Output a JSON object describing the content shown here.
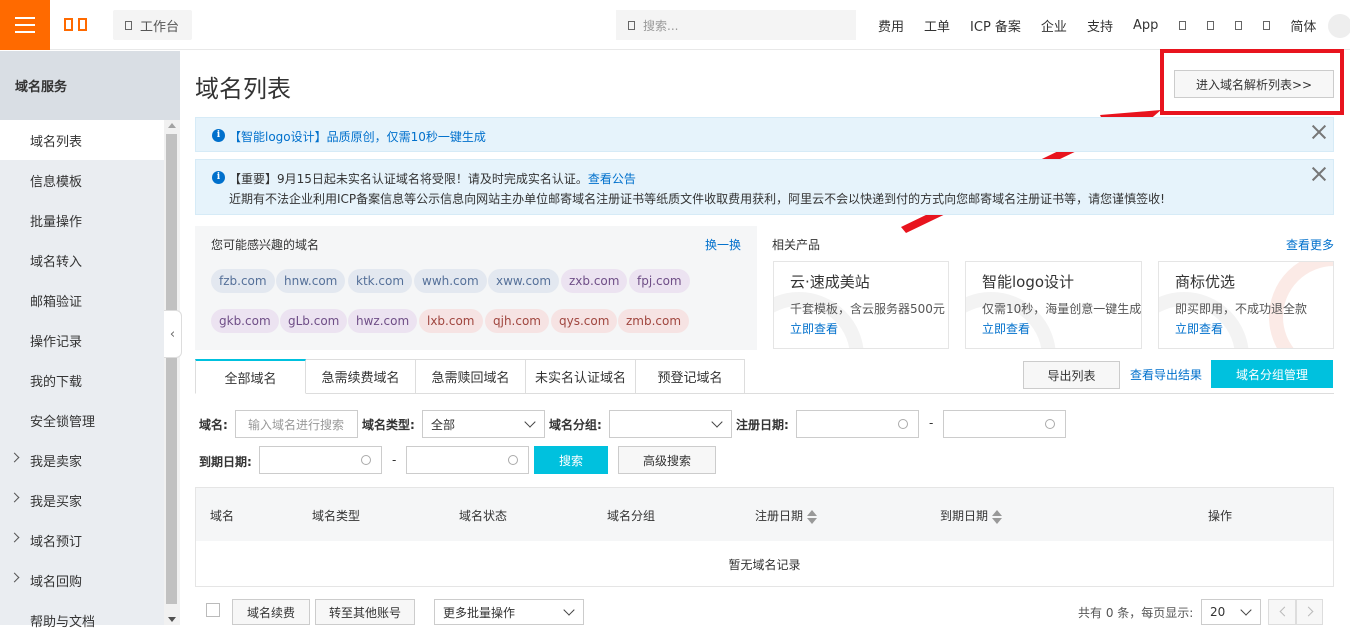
{
  "header": {
    "workbench": "工作台",
    "search_placeholder": "搜索...",
    "links": [
      "费用",
      "工单",
      "ICP 备案",
      "企业",
      "支持",
      "App"
    ],
    "lang": "简体"
  },
  "sidebar": {
    "title": "域名服务",
    "items": [
      {
        "label": "域名列表"
      },
      {
        "label": "信息模板"
      },
      {
        "label": "批量操作"
      },
      {
        "label": "域名转入"
      },
      {
        "label": "邮箱验证"
      },
      {
        "label": "操作记录"
      },
      {
        "label": "我的下载"
      },
      {
        "label": "安全锁管理"
      },
      {
        "label": "我是卖家"
      },
      {
        "label": "我是买家"
      },
      {
        "label": "域名预订"
      },
      {
        "label": "域名回购"
      },
      {
        "label": "帮助与文档"
      }
    ]
  },
  "main": {
    "title": "域名列表",
    "dns_button": "进入域名解析列表>>",
    "notice1": "【智能logo设计】品质原创，仅需10秒一键生成",
    "notice2_line1": "【重要】9月15日起未实名认证域名将受限！请及时完成实名认证。",
    "notice2_link": "查看公告",
    "notice2_line2": "近期有不法企业利用ICP备案信息等公示信息向网站主办单位邮寄域名注册证书等纸质文件收取费用获利，阿里云不会以快递到付的方式向您邮寄域名注册证书等，请您谨慎签收!",
    "interest": {
      "title": "您可能感兴趣的域名",
      "swap": "换一换",
      "row1": [
        "fzb.com",
        "hnw.com",
        "ktk.com",
        "wwh.com",
        "xww.com",
        "zxb.com",
        "fpj.com"
      ],
      "row2": [
        "gkb.com",
        "gLb.com",
        "hwz.com",
        "lxb.com",
        "qjh.com",
        "qys.com",
        "zmb.com"
      ]
    },
    "related": {
      "title": "相关产品",
      "see_more": "查看更多",
      "cards": [
        {
          "name": "云·速成美站",
          "desc": "千套模板，含云服务器500元",
          "link": "立即查看"
        },
        {
          "name": "智能logo设计",
          "desc": "仅需10秒，海量创意一键生成",
          "link": "立即查看"
        },
        {
          "name": "商标优选",
          "desc": "即买即用，不成功退全款",
          "link": "立即查看"
        }
      ]
    },
    "tabs": [
      "全部域名",
      "急需续费域名",
      "急需赎回域名",
      "未实名认证域名",
      "预登记域名"
    ],
    "export_button": "导出列表",
    "export_result_link": "查看导出结果",
    "group_manage_button": "域名分组管理",
    "filters": {
      "domain_label": "域名:",
      "domain_placeholder": "输入域名进行搜索",
      "type_label": "域名类型:",
      "type_value": "全部",
      "group_label": "域名分组:",
      "reg_date_label": "注册日期:",
      "exp_date_label": "到期日期:",
      "dash": "-",
      "search_button": "搜索",
      "advanced_button": "高级搜索"
    },
    "table": {
      "headers": [
        "域名",
        "域名类型",
        "域名状态",
        "域名分组",
        "注册日期",
        "到期日期",
        "操作"
      ],
      "empty": "暂无域名记录"
    },
    "footer": {
      "renew_button": "域名续费",
      "transfer_button": "转至其他账号",
      "more_ops": "更多批量操作",
      "total_text": "共有 0 条，每页显示:",
      "page_size": "20"
    }
  }
}
